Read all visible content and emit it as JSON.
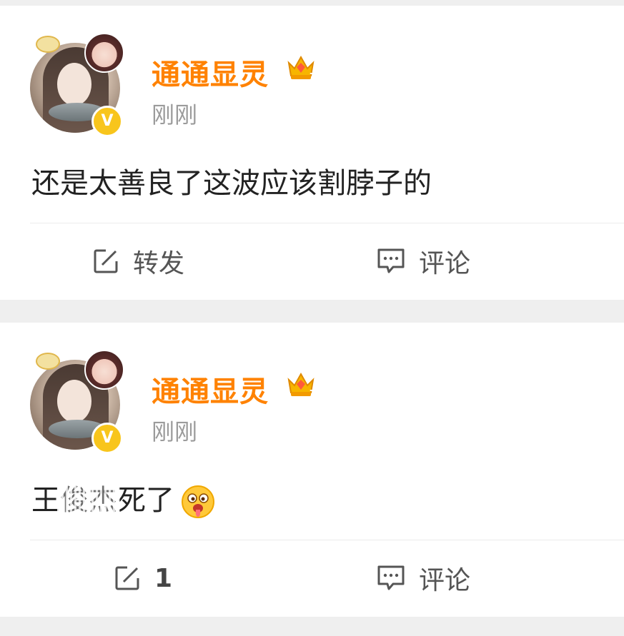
{
  "posts": [
    {
      "username": "通通显灵",
      "time": "刚刚",
      "text": "还是太善良了这波应该割脖子的",
      "repost_label": "转发",
      "comment_label": "评论",
      "verified_mark": "V"
    },
    {
      "username": "通通显灵",
      "time": "刚刚",
      "text_prefix": "王",
      "text_hidden": "俊杰",
      "text_suffix": "死了",
      "repost_label": "1",
      "comment_label": "评论",
      "verified_mark": "V",
      "emoji": "drooling-face-emoji"
    }
  ],
  "colors": {
    "username": "#ff8200",
    "verified_badge": "#f8c51c",
    "time": "#9b9b9b",
    "background": "#efefef"
  },
  "icons": {
    "repost": "repost-icon",
    "comment": "comment-icon",
    "crown": "crown-badge-icon"
  }
}
